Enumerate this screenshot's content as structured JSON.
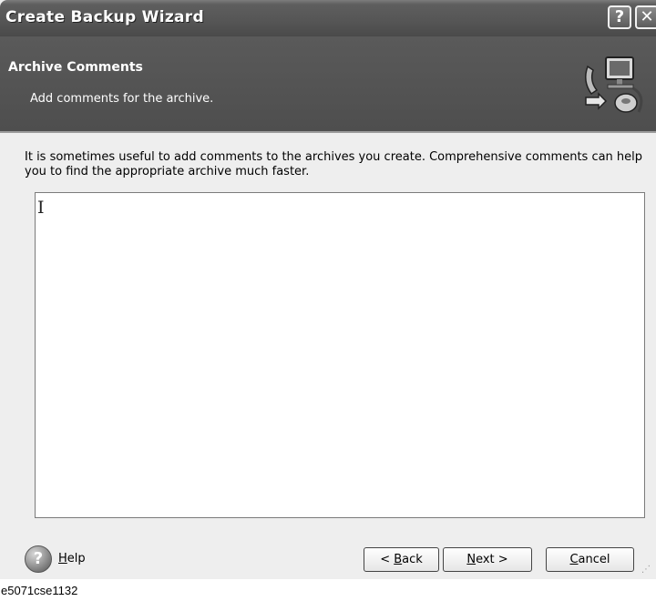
{
  "window": {
    "title": "Create Backup Wizard"
  },
  "titlebar": {
    "help_glyph": "?",
    "close_glyph": "✕"
  },
  "header": {
    "title": "Archive Comments",
    "subtitle": "Add comments for the archive."
  },
  "content": {
    "description": "It is sometimes useful to add comments to the archives you create. Comprehensive comments can help you to find the appropriate archive much faster.",
    "comment_value": ""
  },
  "footer": {
    "help_label": {
      "mnemonic": "H",
      "rest": "elp"
    },
    "back_button": {
      "before": "< ",
      "mnemonic": "B",
      "after": "ack"
    },
    "next_button": {
      "mnemonic": "N",
      "after": "ext >"
    },
    "cancel_button": {
      "mnemonic": "C",
      "after": "ancel"
    }
  },
  "caption": "e5071cse1132",
  "icons": [
    "help-icon",
    "close-icon",
    "backup-computer-icon",
    "help-circle-icon",
    "resize-grip-icon"
  ]
}
